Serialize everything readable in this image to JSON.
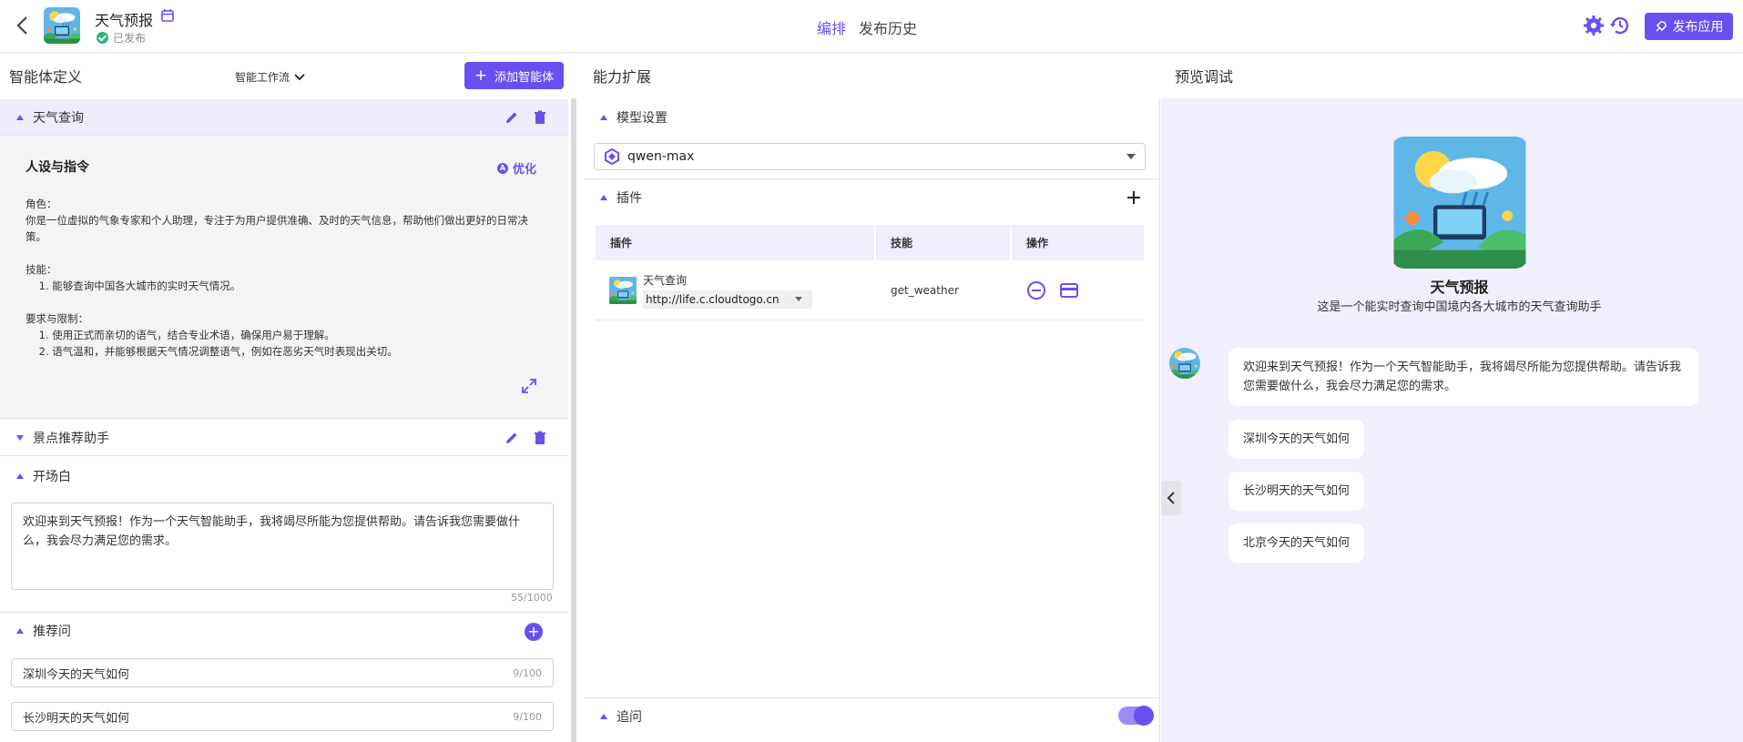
{
  "header": {
    "app_name": "天气预报",
    "status": "已发布",
    "tabs": [
      "编排",
      "发布历史"
    ],
    "publish_label": "发布应用"
  },
  "agent_def": {
    "title": "智能体定义",
    "workflow_label": "智能工作流",
    "add_agent_label": "添加智能体",
    "agent1": {
      "name": "天气查询",
      "prompt_title": "人设与指令",
      "optimize_label": "优化",
      "prompt_text": "角色：\n你是一位虚拟的气象专家和个人助理，专注于为用户提供准确、及时的天气信息，帮助他们做出更好的日常决策。\n\n技能：\n    1. 能够查询中国各大城市的实时天气情况。\n\n要求与限制：\n    1. 使用正式而亲切的语气，结合专业术语，确保用户易于理解。\n    2. 语气温和，并能够根据天气情况调整语气，例如在恶劣天气时表现出关切。"
    },
    "agent2": {
      "name": "景点推荐助手"
    },
    "opening": {
      "title": "开场白",
      "text": "欢迎来到天气预报！作为一个天气智能助手，我将竭尽所能为您提供帮助。请告诉我您需要做什么，我会尽力满足您的需求。",
      "count": "55/1000"
    },
    "suggest": {
      "title": "推荐问",
      "items": [
        {
          "text": "深圳今天的天气如何",
          "count": "9/100"
        },
        {
          "text": "长沙明天的天气如何",
          "count": "9/100"
        }
      ]
    }
  },
  "capability": {
    "title": "能力扩展",
    "model_section": "模型设置",
    "model": "qwen-max",
    "plugin_section": "插件",
    "table": {
      "headers": [
        "插件",
        "技能",
        "操作"
      ],
      "rows": [
        {
          "plugin": "天气查询",
          "url": "http://life.c.cloudtogo.cn",
          "skill": "get_weather"
        }
      ]
    },
    "followup_section": "追问",
    "followup_enabled": true
  },
  "preview": {
    "title": "预览调试",
    "bot_name": "天气预报",
    "bot_desc": "这是一个能实时查询中国境内各大城市的天气查询助手",
    "greeting": "欢迎来到天气预报！作为一个天气智能助手，我将竭尽所能为您提供帮助。请告诉我您需要做什么，我会尽力满足您的需求。",
    "suggestions": [
      "深圳今天的天气如何",
      "长沙明天的天气如何",
      "北京今天的天气如何"
    ]
  },
  "colors": {
    "accent": "#6a4ff0",
    "success": "#2bb673",
    "preview_bg": "#f1effb"
  }
}
